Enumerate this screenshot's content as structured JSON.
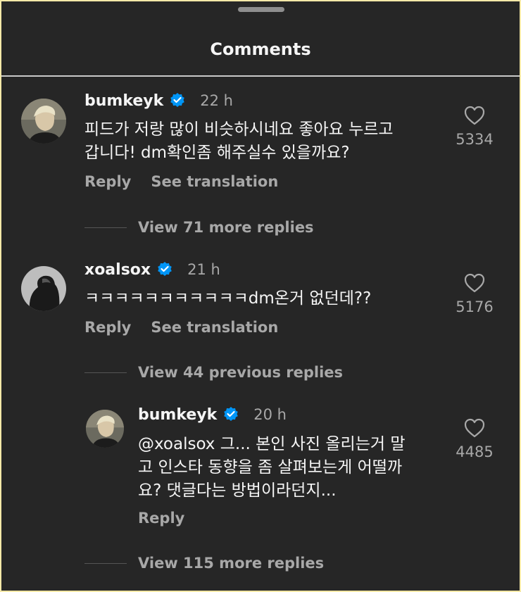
{
  "header": {
    "title": "Comments"
  },
  "comments": [
    {
      "username": "bumkeyk",
      "time": "22 h",
      "text_lines": [
        "피드가 저랑 많이 비슷하시네요 좋아요 누르고",
        "갑니다! dm확인좀 해주실수 있을까요?"
      ],
      "reply_label": "Reply",
      "translate_label": "See translation",
      "likes": "5334",
      "more_replies": "View 71 more replies"
    },
    {
      "username": "xoalsox",
      "time": "21 h",
      "text_lines": [
        "ㅋㅋㅋㅋㅋㅋㅋㅋㅋㅋㅋdm온거 없던데??"
      ],
      "reply_label": "Reply",
      "translate_label": "See translation",
      "likes": "5176",
      "more_replies": "View 44 previous replies"
    }
  ],
  "reply": {
    "username": "bumkeyk",
    "time": "20 h",
    "text_lines": [
      "@xoalsox 그... 본인 사진 올리는거 말",
      "고 인스타 동향을 좀 살펴보는게 어떨까",
      "요? 댓글다는 방법이라던지..."
    ],
    "reply_label": "Reply",
    "likes": "4485",
    "more_replies": "View 115 more replies"
  },
  "colors": {
    "verified": "#0095f6",
    "background": "#262626",
    "secondary_text": "#a8a8a8"
  }
}
